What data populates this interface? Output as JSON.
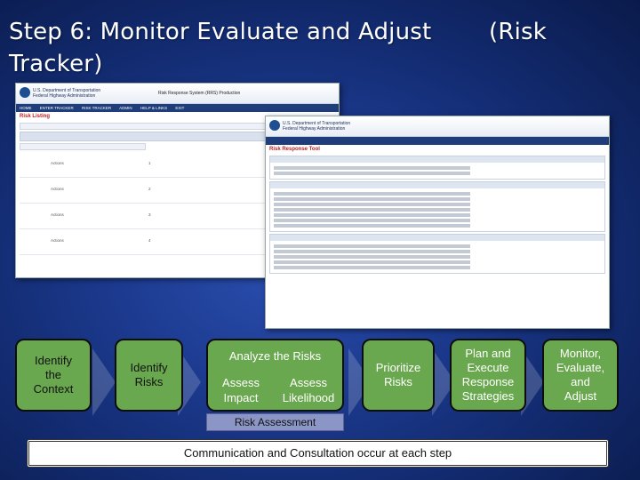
{
  "title": {
    "line1": "Step 6: Monitor Evaluate and Adjust",
    "risk": "(Risk",
    "line2": "Tracker)"
  },
  "screenshot1": {
    "org": "U.S. Department of Transportation Federal Highway Administration",
    "app": "Risk Response System (RRS) Production",
    "nav": [
      "HOME",
      "ENTER TRACKER",
      "RISK TRACKER",
      "ADMIN",
      "HELP & LINKS",
      "EXIT"
    ],
    "page_title": "Risk Listing",
    "rows": [
      {
        "action": "Actions",
        "num": "1"
      },
      {
        "action": "Actions",
        "num": "2"
      },
      {
        "action": "Actions",
        "num": "3"
      },
      {
        "action": "Actions",
        "num": "4"
      }
    ]
  },
  "screenshot2": {
    "org": "U.S. Department of Transportation Federal Highway Administration",
    "page_title": "Risk Response Tool"
  },
  "colors": {
    "box_fill": "#6aa84f",
    "risk_assessment_fill": "#8c96c6",
    "background": "#1c3a8f"
  },
  "process": {
    "identify_context": "Identify\nthe\nContext",
    "identify_risks": "Identify\nRisks",
    "analyze_title": "Analyze the Risks",
    "assess_impact": "Assess\nImpact",
    "assess_likelihood": "Assess\nLikelihood",
    "prioritize": "Prioritize\nRisks",
    "plan": "Plan and\nExecute\nResponse\nStrategies",
    "monitor": "Monitor,\nEvaluate,\nand\nAdjust",
    "risk_assessment": "Risk Assessment",
    "communication": "Communication and Consultation occur at each step"
  }
}
